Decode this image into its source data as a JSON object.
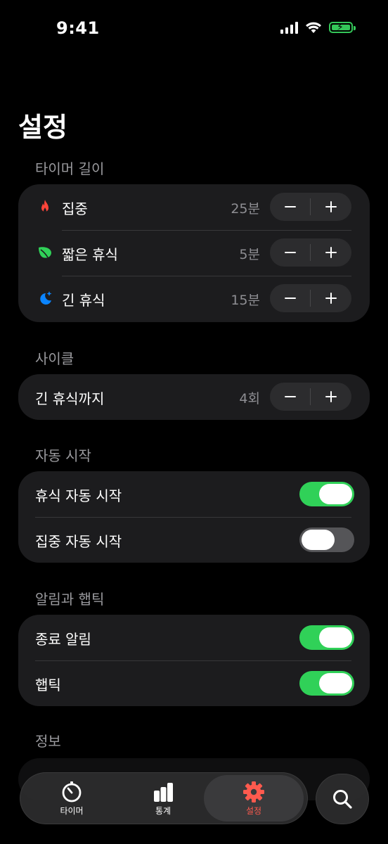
{
  "status_bar": {
    "time": "9:41"
  },
  "page_title": "설정",
  "sections": {
    "timer_length": {
      "label": "타이머 길이",
      "rows": [
        {
          "label": "집중",
          "value": "25분",
          "icon": "flame-icon"
        },
        {
          "label": "짧은 휴식",
          "value": "5분",
          "icon": "leaf-icon"
        },
        {
          "label": "긴 휴식",
          "value": "15분",
          "icon": "moon-stars-icon"
        }
      ]
    },
    "cycle": {
      "label": "사이클",
      "rows": [
        {
          "label": "긴 휴식까지",
          "value": "4회"
        }
      ]
    },
    "auto_start": {
      "label": "자동 시작",
      "rows": [
        {
          "label": "휴식 자동 시작",
          "on": true
        },
        {
          "label": "집중 자동 시작",
          "on": false
        }
      ]
    },
    "alerts": {
      "label": "알림과 햅틱",
      "rows": [
        {
          "label": "종료 알림",
          "on": true
        },
        {
          "label": "햅틱",
          "on": true
        }
      ]
    },
    "info": {
      "label": "정보"
    }
  },
  "tab_bar": {
    "tabs": [
      {
        "label": "타이머",
        "icon": "timer-icon"
      },
      {
        "label": "통계",
        "icon": "chart-bar-icon"
      },
      {
        "label": "설정",
        "icon": "gear-icon",
        "active": true
      }
    ],
    "search_icon": "search-icon"
  },
  "colors": {
    "background": "#000000",
    "card": "#1c1c1e",
    "accent_green": "#30d158",
    "accent_red": "#ff5a4e",
    "accent_blue": "#0a84ff",
    "secondary_text": "#8e8e93"
  }
}
